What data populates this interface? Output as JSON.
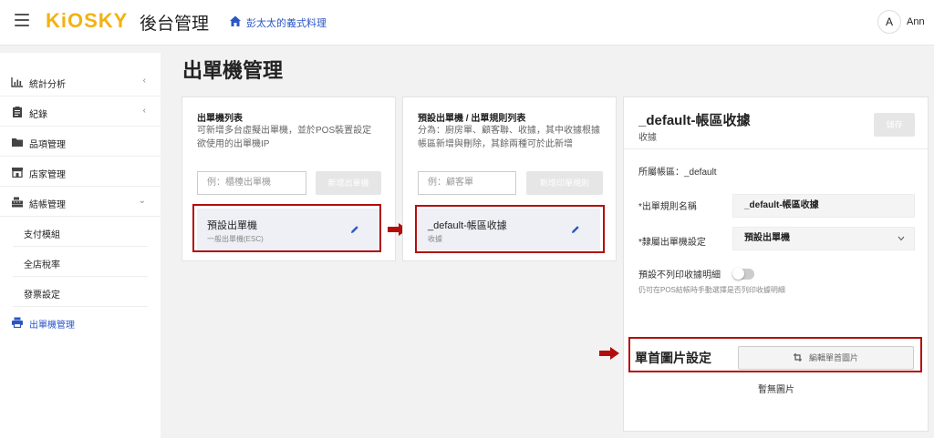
{
  "header": {
    "logo": "KiOSKY",
    "subtitle": "後台管理",
    "store_name": "彭太太的義式料理",
    "avatar_letter": "A",
    "user_name": "Ann"
  },
  "sidebar": {
    "items": [
      {
        "label": "統計分析",
        "icon": "chart-icon",
        "chevron": "‹"
      },
      {
        "label": "紀錄",
        "icon": "clipboard-icon",
        "chevron": "‹"
      },
      {
        "label": "品項管理",
        "icon": "folder-icon",
        "chevron": ""
      },
      {
        "label": "店家管理",
        "icon": "store-icon",
        "chevron": ""
      },
      {
        "label": "結帳管理",
        "icon": "cash-register-icon",
        "chevron": "⌄"
      },
      {
        "label": "支付模組"
      },
      {
        "label": "全店稅率"
      },
      {
        "label": "發票設定"
      },
      {
        "label": "出單機管理",
        "icon": "printer-icon"
      }
    ]
  },
  "page": {
    "title": "出單機管理"
  },
  "printer_list": {
    "title": "出單機列表",
    "desc_line1": "可新增多台虛擬出單機，並於POS裝置設定",
    "desc_line2": "欲使用的出單機IP",
    "input_placeholder": "例：櫃檯出單機",
    "add_button": "新增出單機",
    "item_title": "預設出單機",
    "item_sub": "一般出單機(ESC)"
  },
  "rule_list": {
    "title": "預設出單機 / 出單規則列表",
    "desc_line1": "分為：廚房單、顧客聯、收據，其中收據根據",
    "desc_line2": "帳區新增與刪除，其餘兩種可於此新增",
    "input_placeholder": "例：顧客單",
    "add_button": "新增印單規則",
    "item_title": "_default-帳區收據",
    "item_sub": "收據"
  },
  "detail": {
    "title": "_default-帳區收據",
    "subtitle": "收據",
    "save_button": "儲存",
    "zone_label": "所屬帳區：_default",
    "rule_name_label": "*出單規則名稱",
    "rule_name_value": "_default-帳區收據",
    "printer_label": "*隸屬出單機設定",
    "printer_value": "預設出單機",
    "no_print_label": "預設不列印收據明細",
    "no_print_hint": "仍可在POS結帳時手動選擇是否列印收據明細",
    "no_print_enabled": false,
    "header_image_label": "單首圖片設定",
    "edit_image_button": "編輯單首圖片",
    "no_image_text": "暫無圖片"
  },
  "colors": {
    "logo": "#f2b211",
    "accent_blue": "#2a56c6",
    "highlight_red": "#b30c0c"
  }
}
